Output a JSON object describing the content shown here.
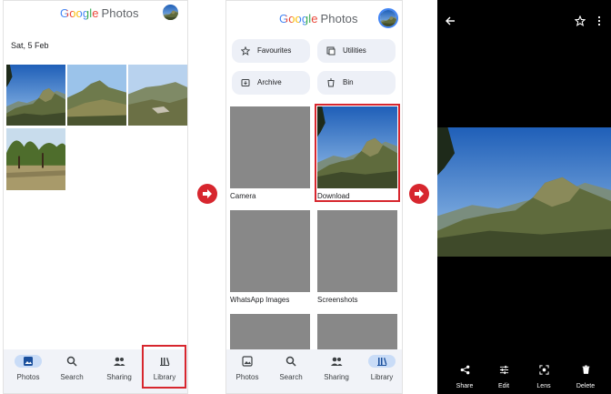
{
  "app": {
    "logo_word": "Google",
    "logo_product": "Photos"
  },
  "colors": {
    "accent_red": "#d7262e",
    "nav_bg": "#f1f3f8",
    "nav_active": "#c9dcf7",
    "chip_bg": "#edf0f7",
    "google_blue": "#4285f4",
    "google_red": "#ea4335",
    "google_yellow": "#fbbc05",
    "google_green": "#34a853"
  },
  "photos_screen": {
    "date_header": "Sat, 5 Feb",
    "nav": {
      "photos": "Photos",
      "search": "Search",
      "sharing": "Sharing",
      "library": "Library"
    }
  },
  "library_screen": {
    "chips": {
      "favourites": "Favourites",
      "utilities": "Utilities",
      "archive": "Archive",
      "bin": "Bin"
    },
    "albums": {
      "camera": "Camera",
      "download": "Download",
      "whatsapp": "WhatsApp Images",
      "screenshots": "Screenshots"
    },
    "nav": {
      "photos": "Photos",
      "search": "Search",
      "sharing": "Sharing",
      "library": "Library"
    }
  },
  "viewer_screen": {
    "actions": {
      "share": "Share",
      "edit": "Edit",
      "lens": "Lens",
      "delete": "Delete"
    }
  },
  "icons": [
    "back-arrow-icon",
    "star-icon",
    "more-vert-icon",
    "share-icon",
    "edit-icon",
    "lens-icon",
    "delete-icon",
    "photos-icon",
    "search-icon",
    "sharing-icon",
    "library-icon",
    "flow-arrow-icon"
  ]
}
